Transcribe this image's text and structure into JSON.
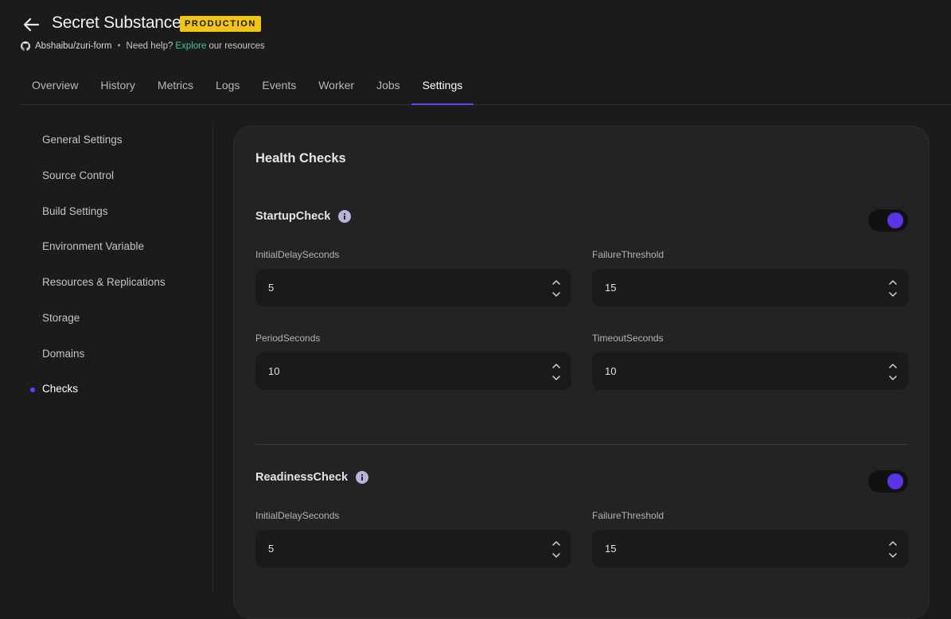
{
  "header": {
    "title": "Secret Substance",
    "badge": "PRODUCTION",
    "repo": "Abshaibu/zuri-form",
    "separator": "•",
    "help_prefix": "Need help?",
    "help_link": "Explore",
    "help_suffix": "our resources"
  },
  "tabs": [
    {
      "label": "Overview"
    },
    {
      "label": "History"
    },
    {
      "label": "Metrics"
    },
    {
      "label": "Logs"
    },
    {
      "label": "Events"
    },
    {
      "label": "Worker"
    },
    {
      "label": "Jobs"
    },
    {
      "label": "Settings",
      "active": true
    }
  ],
  "sidebar": {
    "items": [
      {
        "label": "General Settings"
      },
      {
        "label": "Source Control"
      },
      {
        "label": "Build Settings"
      },
      {
        "label": "Environment Variable"
      },
      {
        "label": "Resources & Replications"
      },
      {
        "label": "Storage"
      },
      {
        "label": "Domains"
      },
      {
        "label": "Checks",
        "active": true
      }
    ]
  },
  "panel": {
    "title": "Health Checks",
    "startup": {
      "title": "StartupCheck",
      "enabled": true,
      "fields": {
        "initial_delay": {
          "label": "InitialDelaySeconds",
          "value": "5"
        },
        "failure_threshold": {
          "label": "FailureThreshold",
          "value": "15"
        },
        "period": {
          "label": "PeriodSeconds",
          "value": "10"
        },
        "timeout": {
          "label": "TimeoutSeconds",
          "value": "10"
        }
      }
    },
    "readiness": {
      "title": "ReadinessCheck",
      "enabled": true,
      "fields": {
        "initial_delay": {
          "label": "InitialDelaySeconds",
          "value": "5"
        },
        "failure_threshold": {
          "label": "FailureThreshold",
          "value": "15"
        }
      }
    }
  },
  "colors": {
    "accent": "#6a3df0",
    "badge": "#f0c419",
    "link": "#4fc3a1",
    "background": "#1b1b1c",
    "panel": "#232325"
  },
  "icons": {
    "back": "arrow-left-icon",
    "repo": "github-icon",
    "info": "info-icon",
    "step_up": "chevron-up-icon",
    "step_down": "chevron-down-icon"
  }
}
